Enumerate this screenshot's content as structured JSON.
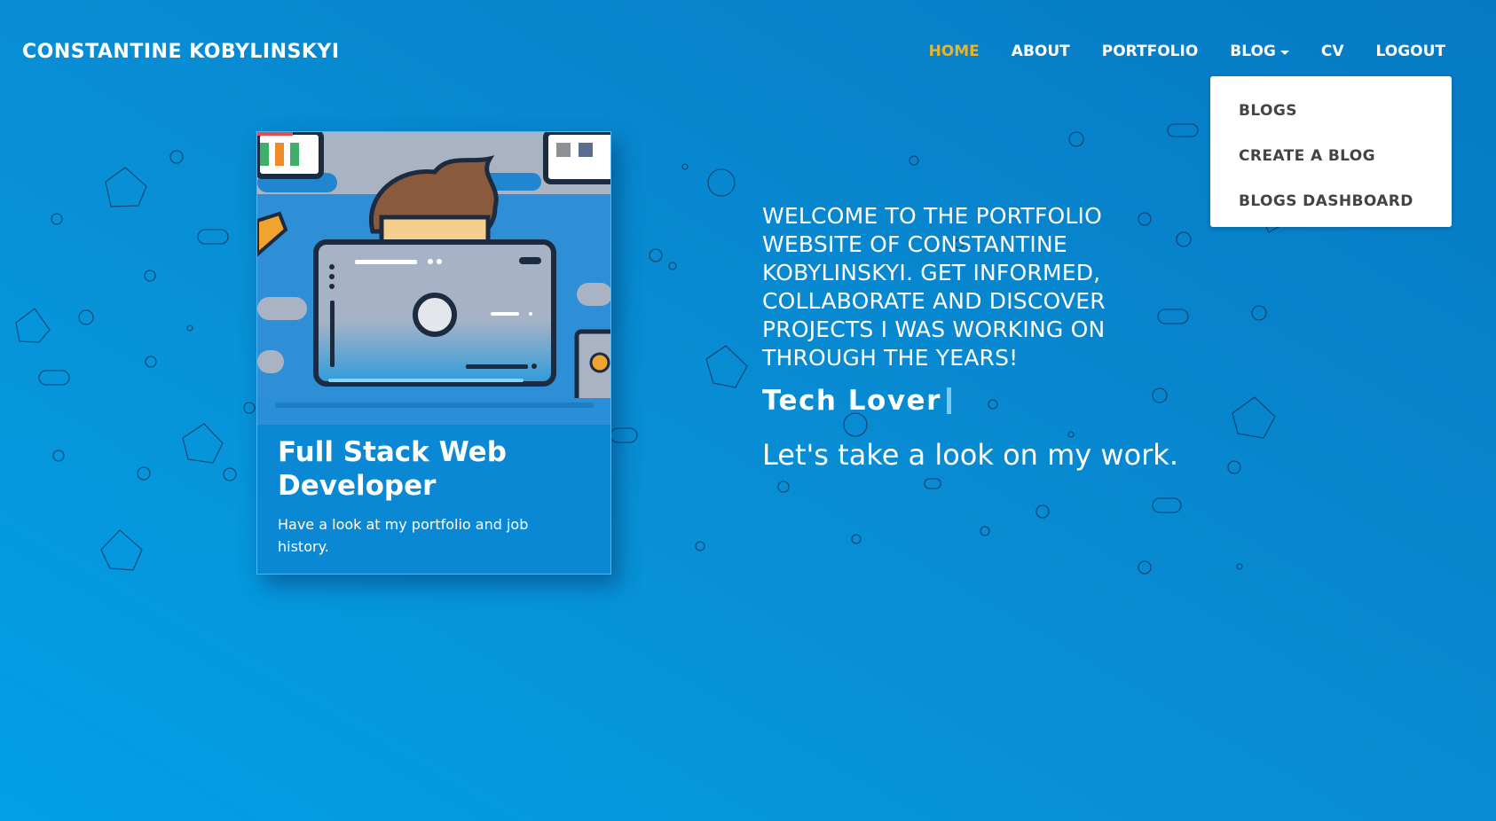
{
  "navbar": {
    "brand": "CONSTANTINE KOBYLINSKYI",
    "links": [
      {
        "label": "HOME",
        "active": true
      },
      {
        "label": "ABOUT"
      },
      {
        "label": "PORTFOLIO"
      },
      {
        "label": "BLOG"
      },
      {
        "label": "CV"
      },
      {
        "label": "LOGOUT"
      }
    ],
    "blog_dropdown": [
      "BLOGS",
      "CREATE A BLOG",
      "BLOGS DASHBOARD"
    ]
  },
  "card": {
    "title": "Full Stack Web Developer",
    "text": "Have a look at my portfolio and job history."
  },
  "hero": {
    "welcome": "WELCOME TO THE PORTFOLIO WEBSITE OF CONSTANTINE KOBYLINSKYI. GET INFORMED, COLLABORATE AND DISCOVER PROJECTS I WAS WORKING ON THROUGH THE YEARS!",
    "typed_text": "Tech Lover",
    "tagline": "Let's take a look on my work."
  },
  "colors": {
    "background_start": "#02a0e6",
    "background_end": "#0679c4",
    "active_nav": "#e9b42b",
    "dropdown_text": "#444444"
  }
}
